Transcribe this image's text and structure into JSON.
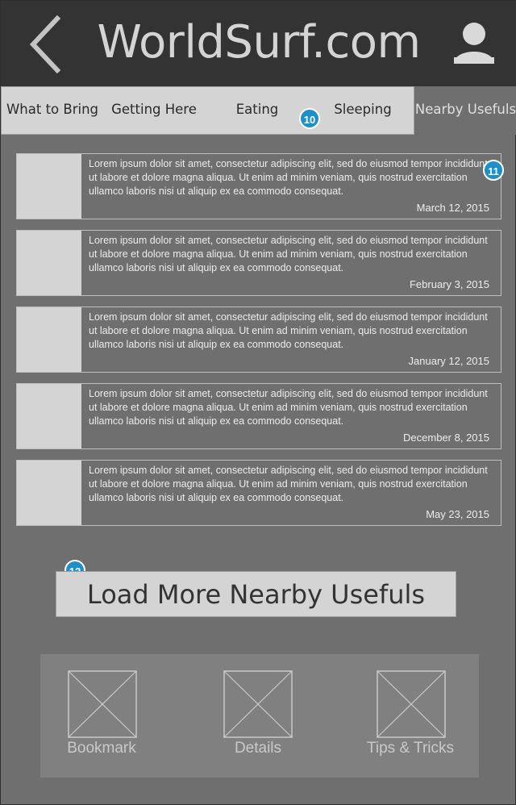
{
  "header": {
    "title": "WorldSurf.com",
    "back_icon": "chevron-left-icon",
    "profile_icon": "user-icon"
  },
  "tabs": [
    {
      "label": "What to Bring",
      "active": false
    },
    {
      "label": "Getting Here",
      "active": false
    },
    {
      "label": "Eating",
      "active": false
    },
    {
      "label": "Sleeping",
      "active": false
    },
    {
      "label": "Nearby Usefuls",
      "active": true
    }
  ],
  "annotations": {
    "tabs_marker": "10",
    "list_marker": "11",
    "load_more_marker": "12"
  },
  "list": {
    "items": [
      {
        "text": "Lorem ipsum dolor sit amet, consectetur adipiscing elit, sed do eiusmod tempor incididunt ut labore et dolore magna aliqua. Ut enim ad minim veniam, quis nostrud exercitation ullamco laboris nisi ut aliquip ex ea commodo consequat.",
        "date": "March 12, 2015"
      },
      {
        "text": "Lorem ipsum dolor sit amet, consectetur adipiscing elit, sed do eiusmod tempor incididunt ut labore et dolore magna aliqua. Ut enim ad minim veniam, quis nostrud exercitation ullamco laboris nisi ut aliquip ex ea commodo consequat.",
        "date": "February 3, 2015"
      },
      {
        "text": "Lorem ipsum dolor sit amet, consectetur adipiscing elit, sed do eiusmod tempor incididunt ut labore et dolore magna aliqua. Ut enim ad minim veniam, quis nostrud exercitation ullamco laboris nisi ut aliquip ex ea commodo consequat.",
        "date": "January 12, 2015"
      },
      {
        "text": "Lorem ipsum dolor sit amet, consectetur adipiscing elit, sed do eiusmod tempor incididunt ut labore et dolore magna aliqua. Ut enim ad minim veniam, quis nostrud exercitation ullamco laboris nisi ut aliquip ex ea commodo consequat.",
        "date": "December 8, 2015"
      },
      {
        "text": "Lorem ipsum dolor sit amet, consectetur adipiscing elit, sed do eiusmod tempor incididunt ut labore et dolore magna aliqua. Ut enim ad minim veniam, quis nostrud exercitation ullamco laboris nisi ut aliquip ex ea commodo consequat.",
        "date": "May 23,  2015"
      }
    ]
  },
  "load_more": {
    "label": "Load More Nearby Usefuls"
  },
  "bottom_nav": {
    "items": [
      {
        "label": "Bookmark"
      },
      {
        "label": "Details"
      },
      {
        "label": "Tips & Tricks"
      }
    ]
  },
  "colors": {
    "header_bg": "#333333",
    "page_bg": "#6f6f6f",
    "panel_light": "#d4d4d4",
    "badge": "#1d8fc9"
  }
}
